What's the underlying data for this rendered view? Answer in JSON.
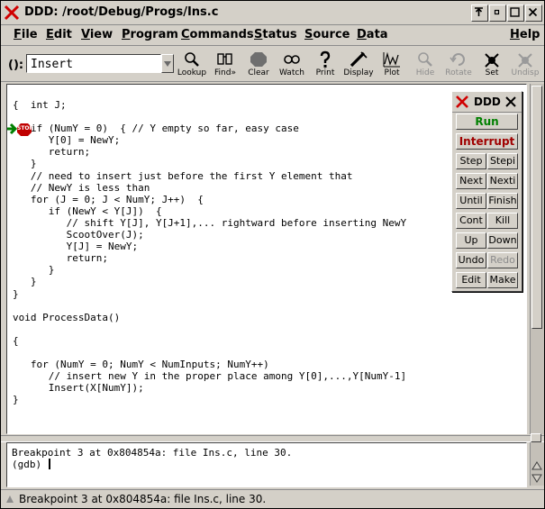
{
  "window": {
    "title": "DDD: /root/Debug/Progs/Ins.c"
  },
  "menubar": {
    "items": [
      {
        "label": "File",
        "accel": "F",
        "rest": "ile"
      },
      {
        "label": "Edit",
        "accel": "E",
        "rest": "dit"
      },
      {
        "label": "View",
        "accel": "V",
        "rest": "iew"
      },
      {
        "label": "Program",
        "accel": "P",
        "rest": "rogram"
      },
      {
        "label": "Commands",
        "accel": "C",
        "rest": "ommands"
      },
      {
        "label": "Status",
        "accel": "S",
        "rest": "tatus"
      },
      {
        "label": "Source",
        "accel": "S",
        "rest": "ource"
      },
      {
        "label": "Data",
        "accel": "D",
        "rest": "ata"
      },
      {
        "label": "Help",
        "accel": "H",
        "rest": "elp"
      }
    ]
  },
  "toolbar": {
    "arg_label": "():",
    "arg_value": "Insert",
    "buttons": [
      {
        "label": "Lookup",
        "icon": "lookup-icon",
        "enabled": true
      },
      {
        "label": "Find»",
        "icon": "find-icon",
        "enabled": true
      },
      {
        "label": "Clear",
        "icon": "stop-clear-icon",
        "enabled": true
      },
      {
        "label": "Watch",
        "icon": "watch-icon",
        "enabled": true
      },
      {
        "label": "Print",
        "icon": "print-icon",
        "enabled": true
      },
      {
        "label": "Display",
        "icon": "display-icon",
        "enabled": true
      },
      {
        "label": "Plot",
        "icon": "plot-icon",
        "enabled": true
      },
      {
        "label": "Hide",
        "icon": "hide-icon",
        "enabled": false
      },
      {
        "label": "Rotate",
        "icon": "rotate-icon",
        "enabled": false
      },
      {
        "label": "Set",
        "icon": "set-icon",
        "enabled": true
      },
      {
        "label": "Undisp",
        "icon": "undisp-icon",
        "enabled": false
      }
    ]
  },
  "source": {
    "lines": [
      "{  int J;",
      "",
      "   if (NumY = 0)  { // Y empty so far, easy case",
      "      Y[0] = NewY;",
      "      return;",
      "   }",
      "   // need to insert just before the first Y element that",
      "   // NewY is less than",
      "   for (J = 0; J < NumY; J++)  {",
      "      if (NewY < Y[J])  {",
      "         // shift Y[J], Y[J+1],... rightward before inserting NewY",
      "         ScootOver(J);",
      "         Y[J] = NewY;",
      "         return;",
      "      }",
      "   }",
      "}",
      "",
      "void ProcessData()",
      "",
      "{",
      "",
      "   for (NumY = 0; NumY < NumInputs; NumY++)",
      "      // insert new Y in the proper place among Y[0],...,Y[NumY-1]",
      "      Insert(X[NumY]);",
      "}"
    ],
    "breakpoint_label": "STOP",
    "breakpoint_line_index": 2
  },
  "console": {
    "line1": "Breakpoint 3 at 0x804854a: file Ins.c, line 30.",
    "prompt": "(gdb) "
  },
  "statusbar": {
    "text": "Breakpoint 3 at 0x804854a: file Ins.c, line 30."
  },
  "command_tool": {
    "title": "DDD",
    "run": "Run",
    "interrupt": "Interrupt",
    "buttons": [
      [
        "Step",
        "Stepi"
      ],
      [
        "Next",
        "Nexti"
      ],
      [
        "Until",
        "Finish"
      ],
      [
        "Cont",
        "Kill"
      ],
      [
        "Up",
        "Down"
      ],
      [
        "Undo",
        "Redo"
      ],
      [
        "Edit",
        "Make"
      ]
    ],
    "disabled": [
      "Redo"
    ]
  },
  "colors": {
    "run": "#008000",
    "interrupt": "#a00000",
    "logo_x": "#d00000",
    "exec_arrow": "#008000",
    "stop_sign": "#c00000"
  }
}
